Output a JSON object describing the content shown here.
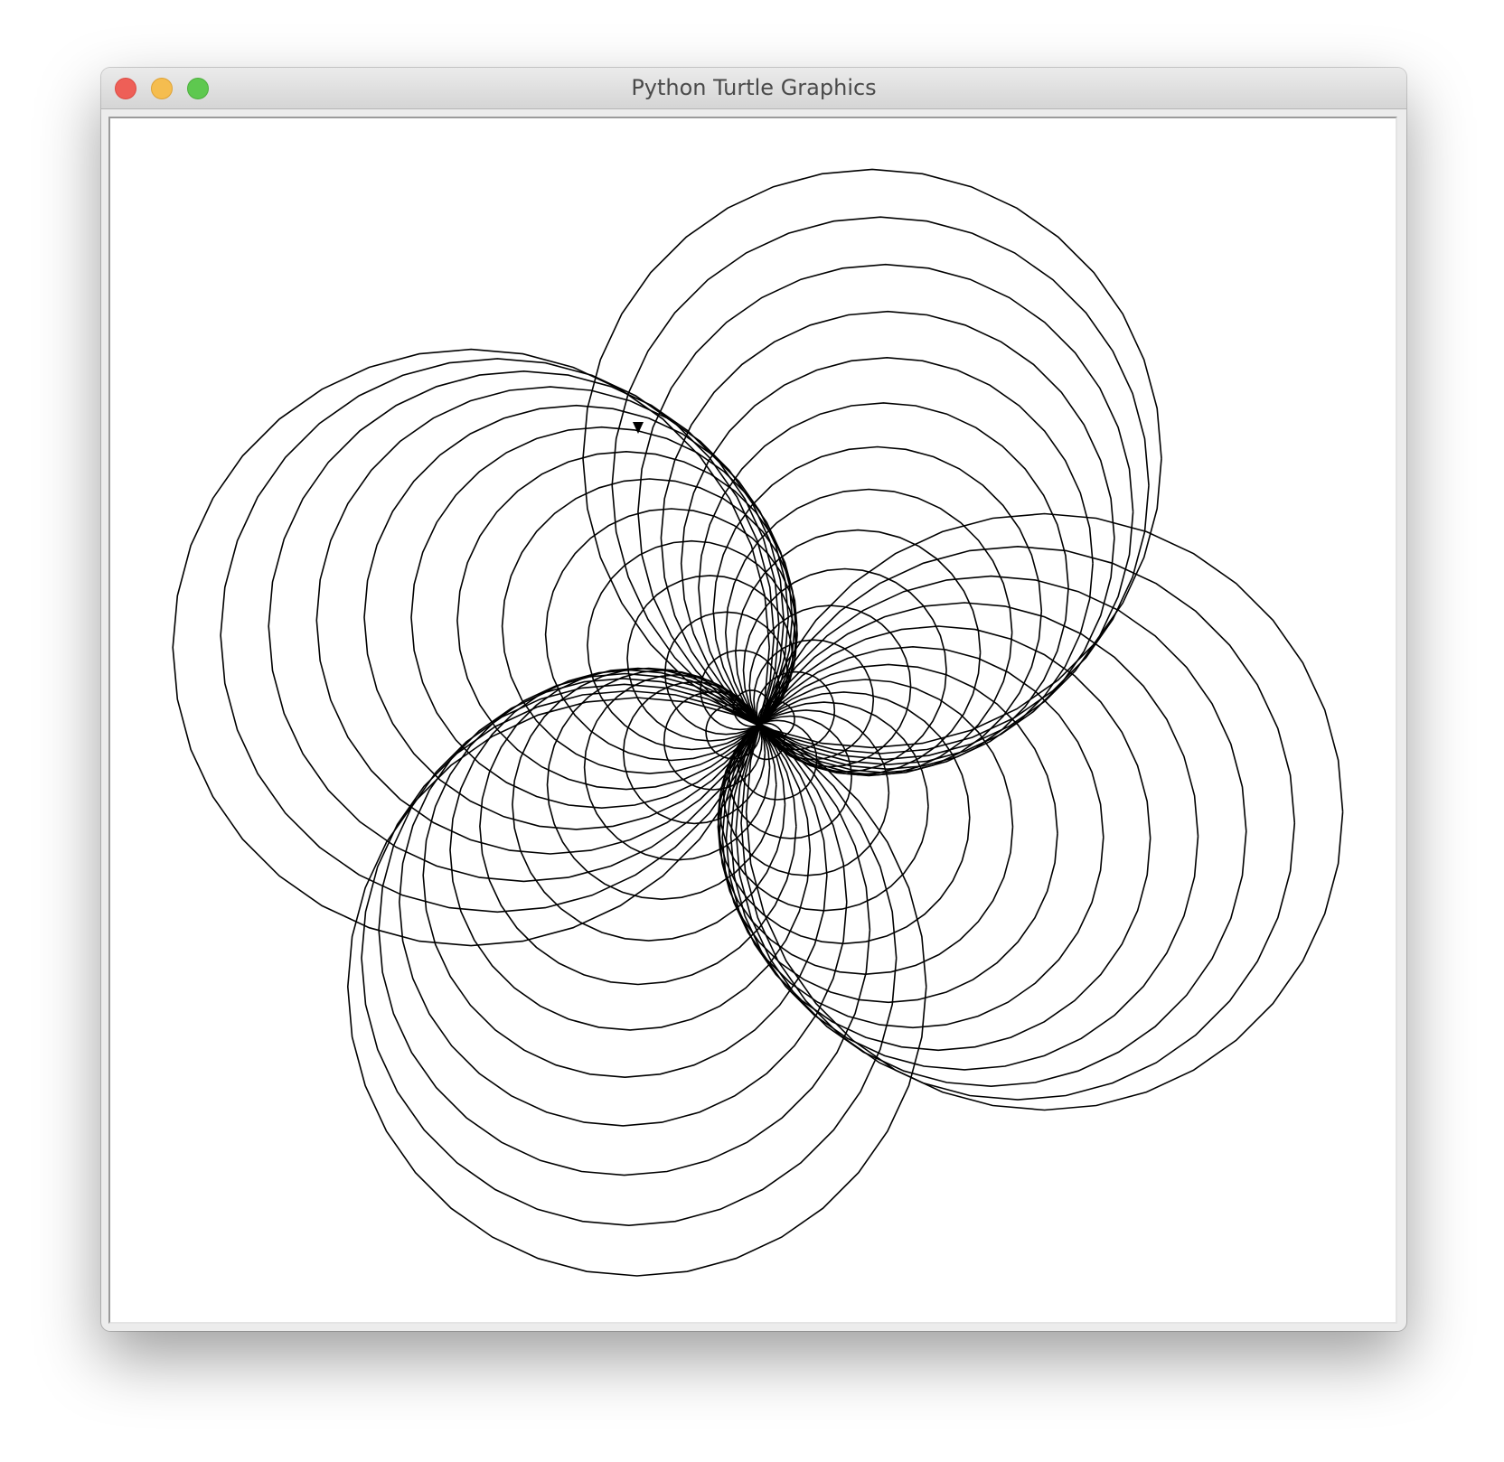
{
  "window": {
    "title": "Python Turtle Graphics"
  },
  "drawing": {
    "pen_color": "#000000",
    "canvas_background": "#ffffff",
    "turtle_shape": "classic-arrow",
    "petals": 4
  }
}
